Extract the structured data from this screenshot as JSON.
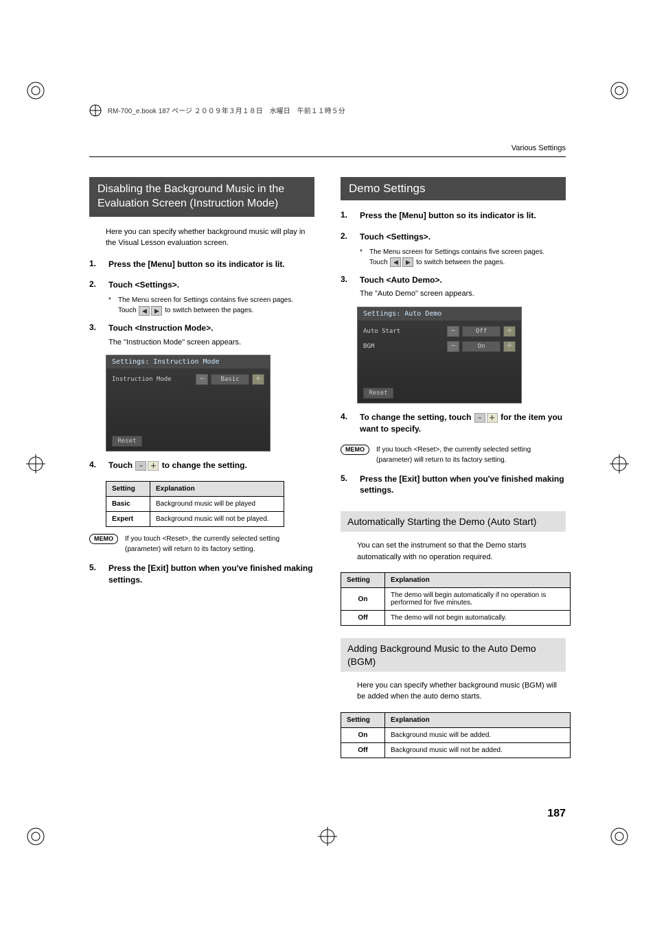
{
  "header_line": "RM-700_e.book  187 ページ  ２００９年３月１８日　水曜日　午前１１時５分",
  "header_right": "Various Settings",
  "page_number": "187",
  "memo_label": "MEMO",
  "left": {
    "banner": "Disabling the Background Music in the Evaluation Screen (Instruction Mode)",
    "intro": "Here you can specify whether background music will play in the Visual Lesson evaluation screen.",
    "steps": {
      "1": {
        "title": "Press the [Menu] button so its indicator is lit."
      },
      "2": {
        "title": "Touch <Settings>.",
        "note_a": "The Menu screen for Settings contains five screen pages.",
        "note_b_pre": "Touch ",
        "note_b_post": " to switch between the pages."
      },
      "3": {
        "title": "Touch <Instruction Mode>.",
        "sub": "The \"Instruction Mode\" screen appears."
      },
      "4": {
        "title_pre": "Touch ",
        "title_post": " to change the setting."
      },
      "5": {
        "title": "Press the [Exit] button when you've finished making settings."
      }
    },
    "screenshot": {
      "title": "Settings: Instruction Mode",
      "row_label": "Instruction Mode",
      "row_value": "Basic",
      "reset": "Reset"
    },
    "table": {
      "h1": "Setting",
      "h2": "Explanation",
      "r1k": "Basic",
      "r1v": "Background music will be played",
      "r2k": "Expert",
      "r2v": "Background music will not be played."
    },
    "memo": "If you touch <Reset>, the currently selected setting (parameter) will return to its factory setting."
  },
  "right": {
    "banner": "Demo Settings",
    "steps": {
      "1": {
        "title": "Press the [Menu] button so its indicator is lit."
      },
      "2": {
        "title": "Touch <Settings>.",
        "note_a": "The Menu screen for Settings contains five screen pages.",
        "note_b_pre": "Touch ",
        "note_b_post": " to switch between the pages."
      },
      "3": {
        "title": "Touch <Auto Demo>.",
        "sub": "The \"Auto Demo\" screen appears."
      },
      "4": {
        "title_pre": "To change the setting, touch ",
        "title_post": " for the item you want to specify."
      },
      "5": {
        "title": "Press the [Exit] button when you've finished making settings."
      }
    },
    "screenshot": {
      "title": "Settings: Auto Demo",
      "rows": [
        {
          "label": "Auto Start",
          "value": "Off"
        },
        {
          "label": "BGM",
          "value": "On"
        }
      ],
      "reset": "Reset"
    },
    "memo": "If you touch <Reset>, the currently selected setting (parameter) will return to its factory setting.",
    "sub1": {
      "heading": "Automatically Starting the Demo (Auto Start)",
      "intro": "You can set the instrument so that the Demo starts automatically with no operation required.",
      "table": {
        "h1": "Setting",
        "h2": "Explanation",
        "r1k": "On",
        "r1v": "The demo will begin automatically if no operation is performed for five minutes.",
        "r2k": "Off",
        "r2v": "The demo will not begin automatically."
      }
    },
    "sub2": {
      "heading": "Adding Background Music to the Auto Demo (BGM)",
      "intro": "Here you can specify whether background music (BGM) will be added when the auto demo starts.",
      "table": {
        "h1": "Setting",
        "h2": "Explanation",
        "r1k": "On",
        "r1v": "Background music will be added.",
        "r2k": "Off",
        "r2v": "Background music will not be added."
      }
    }
  }
}
